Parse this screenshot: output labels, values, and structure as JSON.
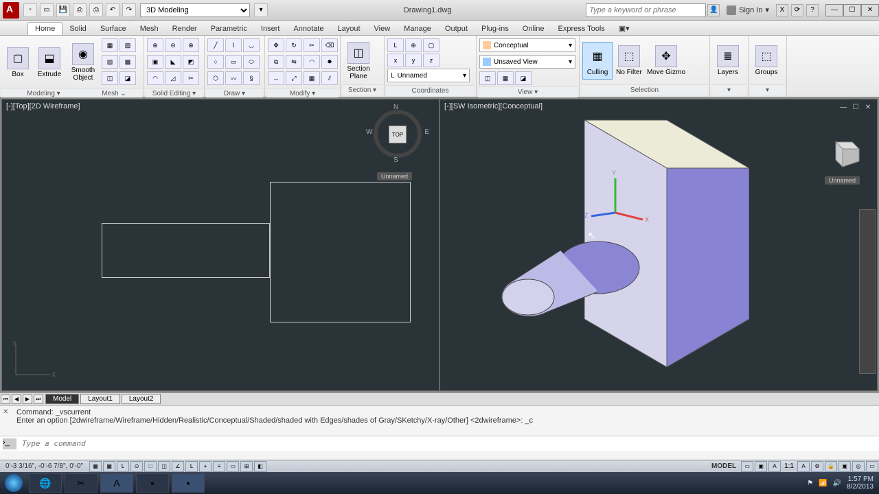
{
  "title": "Drawing1.dwg",
  "workspace": "3D Modeling",
  "search_placeholder": "Type a keyword or phrase",
  "signin": "Sign In",
  "tabs": [
    "Home",
    "Solid",
    "Surface",
    "Mesh",
    "Render",
    "Parametric",
    "Insert",
    "Annotate",
    "Layout",
    "View",
    "Manage",
    "Output",
    "Plug-ins",
    "Online",
    "Express Tools"
  ],
  "active_tab": "Home",
  "panels": {
    "modeling": {
      "label": "Modeling",
      "box": "Box",
      "extrude": "Extrude",
      "smooth": "Smooth Object"
    },
    "mesh": {
      "label": "Mesh"
    },
    "solid_editing": {
      "label": "Solid Editing"
    },
    "draw": {
      "label": "Draw"
    },
    "modify": {
      "label": "Modify"
    },
    "section": {
      "label": "Section",
      "plane": "Section Plane"
    },
    "coordinates": {
      "label": "Coordinates",
      "named": "Unnamed"
    },
    "view": {
      "label": "View",
      "style": "Conceptual",
      "saved": "Unsaved View"
    },
    "selection": {
      "label": "Selection",
      "culling": "Culling",
      "nofilter": "No Filter",
      "gizmo": "Move Gizmo"
    },
    "layers": {
      "label": "Layers"
    },
    "groups": {
      "label": "Groups"
    }
  },
  "viewport_left": {
    "label": "[-][Top][2D Wireframe]",
    "cube_face": "TOP",
    "cube_tag": "Unnamed"
  },
  "viewport_right": {
    "label": "[-][SW Isometric][Conceptual]",
    "cube_tag": "Unnamed"
  },
  "layout_tabs": [
    "Model",
    "Layout1",
    "Layout2"
  ],
  "command": {
    "line1": "Command: _vscurrent",
    "line2": "Enter an option [2dwireframe/Wireframe/Hidden/Realistic/Conceptual/Shaded/shaded with Edges/shades of Gray/SKetchy/X-ray/Other] <2dwireframe>: _c",
    "placeholder": "Type a command"
  },
  "status": {
    "coords": "0'-3 3/16\", -0'-6 7/8\", 0'-0\"",
    "mode": "MODEL",
    "scale": "1:1"
  },
  "tray": {
    "time": "1:57 PM",
    "date": "8/2/2013"
  }
}
